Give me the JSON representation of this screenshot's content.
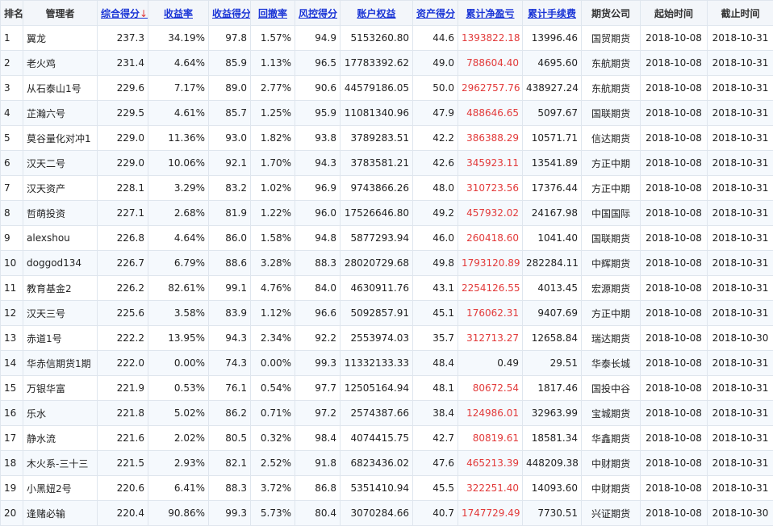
{
  "headers": {
    "rank": "排名",
    "manager": "管理者",
    "overall": "综合得分",
    "return_rate": "收益率",
    "return_score": "收益得分",
    "drawdown": "回撤率",
    "risk_score": "风控得分",
    "equity": "账户权益",
    "asset_score": "资产得分",
    "net_pnl": "累计净盈亏",
    "fees": "累计手续费",
    "broker": "期货公司",
    "start_time": "起始时间",
    "end_time": "截止时间",
    "sort_arrow": "↓"
  },
  "colors": {
    "link_header": "#1a35d6",
    "profit_red": "#e23a3a",
    "grid_line": "#dfe6ee",
    "header_bg": "#f3f6fa",
    "stripe_bg": "#f5f9fd"
  },
  "rows": [
    {
      "rank": "1",
      "manager": "翼龙",
      "overall": "237.3",
      "return_rate": "34.19%",
      "return_score": "97.8",
      "drawdown": "1.57%",
      "risk_score": "94.9",
      "equity": "5153260.80",
      "asset_score": "44.6",
      "net_pnl": "1393822.18",
      "fees": "13996.46",
      "broker": "国贸期货",
      "start_time": "2018-10-08",
      "end_time": "2018-10-31"
    },
    {
      "rank": "2",
      "manager": "老火鸡",
      "overall": "231.4",
      "return_rate": "4.64%",
      "return_score": "85.9",
      "drawdown": "1.13%",
      "risk_score": "96.5",
      "equity": "17783392.62",
      "asset_score": "49.0",
      "net_pnl": "788604.40",
      "fees": "4695.60",
      "broker": "东航期货",
      "start_time": "2018-10-08",
      "end_time": "2018-10-31"
    },
    {
      "rank": "3",
      "manager": "从石泰山1号",
      "overall": "229.6",
      "return_rate": "7.17%",
      "return_score": "89.0",
      "drawdown": "2.77%",
      "risk_score": "90.6",
      "equity": "44579186.05",
      "asset_score": "50.0",
      "net_pnl": "2962757.76",
      "fees": "438927.24",
      "broker": "东航期货",
      "start_time": "2018-10-08",
      "end_time": "2018-10-31"
    },
    {
      "rank": "4",
      "manager": "芷瀚六号",
      "overall": "229.5",
      "return_rate": "4.61%",
      "return_score": "85.7",
      "drawdown": "1.25%",
      "risk_score": "95.9",
      "equity": "11081340.96",
      "asset_score": "47.9",
      "net_pnl": "488646.65",
      "fees": "5097.67",
      "broker": "国联期货",
      "start_time": "2018-10-08",
      "end_time": "2018-10-31"
    },
    {
      "rank": "5",
      "manager": "莫谷量化对冲1",
      "overall": "229.0",
      "return_rate": "11.36%",
      "return_score": "93.0",
      "drawdown": "1.82%",
      "risk_score": "93.8",
      "equity": "3789283.51",
      "asset_score": "42.2",
      "net_pnl": "386388.29",
      "fees": "10571.71",
      "broker": "信达期货",
      "start_time": "2018-10-08",
      "end_time": "2018-10-31"
    },
    {
      "rank": "6",
      "manager": "汉天二号",
      "overall": "229.0",
      "return_rate": "10.06%",
      "return_score": "92.1",
      "drawdown": "1.70%",
      "risk_score": "94.3",
      "equity": "3783581.21",
      "asset_score": "42.6",
      "net_pnl": "345923.11",
      "fees": "13541.89",
      "broker": "方正中期",
      "start_time": "2018-10-08",
      "end_time": "2018-10-31"
    },
    {
      "rank": "7",
      "manager": "汉天资产",
      "overall": "228.1",
      "return_rate": "3.29%",
      "return_score": "83.2",
      "drawdown": "1.02%",
      "risk_score": "96.9",
      "equity": "9743866.26",
      "asset_score": "48.0",
      "net_pnl": "310723.56",
      "fees": "17376.44",
      "broker": "方正中期",
      "start_time": "2018-10-08",
      "end_time": "2018-10-31"
    },
    {
      "rank": "8",
      "manager": "哲萌投资",
      "overall": "227.1",
      "return_rate": "2.68%",
      "return_score": "81.9",
      "drawdown": "1.22%",
      "risk_score": "96.0",
      "equity": "17526646.80",
      "asset_score": "49.2",
      "net_pnl": "457932.02",
      "fees": "24167.98",
      "broker": "中国国际",
      "start_time": "2018-10-08",
      "end_time": "2018-10-31"
    },
    {
      "rank": "9",
      "manager": "alexshou",
      "overall": "226.8",
      "return_rate": "4.64%",
      "return_score": "86.0",
      "drawdown": "1.58%",
      "risk_score": "94.8",
      "equity": "5877293.94",
      "asset_score": "46.0",
      "net_pnl": "260418.60",
      "fees": "1041.40",
      "broker": "国联期货",
      "start_time": "2018-10-08",
      "end_time": "2018-10-31"
    },
    {
      "rank": "10",
      "manager": "doggod134",
      "overall": "226.7",
      "return_rate": "6.79%",
      "return_score": "88.6",
      "drawdown": "3.28%",
      "risk_score": "88.3",
      "equity": "28020729.68",
      "asset_score": "49.8",
      "net_pnl": "1793120.89",
      "fees": "282284.11",
      "broker": "中辉期货",
      "start_time": "2018-10-08",
      "end_time": "2018-10-31"
    },
    {
      "rank": "11",
      "manager": "教育基金2",
      "overall": "226.2",
      "return_rate": "82.61%",
      "return_score": "99.1",
      "drawdown": "4.76%",
      "risk_score": "84.0",
      "equity": "4630911.76",
      "asset_score": "43.1",
      "net_pnl": "2254126.55",
      "fees": "4013.45",
      "broker": "宏源期货",
      "start_time": "2018-10-08",
      "end_time": "2018-10-31"
    },
    {
      "rank": "12",
      "manager": "汉天三号",
      "overall": "225.6",
      "return_rate": "3.58%",
      "return_score": "83.9",
      "drawdown": "1.12%",
      "risk_score": "96.6",
      "equity": "5092857.91",
      "asset_score": "45.1",
      "net_pnl": "176062.31",
      "fees": "9407.69",
      "broker": "方正中期",
      "start_time": "2018-10-08",
      "end_time": "2018-10-31"
    },
    {
      "rank": "13",
      "manager": "赤道1号",
      "overall": "222.2",
      "return_rate": "13.95%",
      "return_score": "94.3",
      "drawdown": "2.34%",
      "risk_score": "92.2",
      "equity": "2553974.03",
      "asset_score": "35.7",
      "net_pnl": "312713.27",
      "fees": "12658.84",
      "broker": "瑞达期货",
      "start_time": "2018-10-08",
      "end_time": "2018-10-30"
    },
    {
      "rank": "14",
      "manager": "华赤信期货1期",
      "overall": "222.0",
      "return_rate": "0.00%",
      "return_score": "74.3",
      "drawdown": "0.00%",
      "risk_score": "99.3",
      "equity": "11332133.33",
      "asset_score": "48.4",
      "net_pnl": "0.49",
      "fees": "29.51",
      "broker": "华泰长城",
      "start_time": "2018-10-08",
      "end_time": "2018-10-31"
    },
    {
      "rank": "15",
      "manager": "万银华富",
      "overall": "221.9",
      "return_rate": "0.53%",
      "return_score": "76.1",
      "drawdown": "0.54%",
      "risk_score": "97.7",
      "equity": "12505164.94",
      "asset_score": "48.1",
      "net_pnl": "80672.54",
      "fees": "1817.46",
      "broker": "国投中谷",
      "start_time": "2018-10-08",
      "end_time": "2018-10-31"
    },
    {
      "rank": "16",
      "manager": "乐水",
      "overall": "221.8",
      "return_rate": "5.02%",
      "return_score": "86.2",
      "drawdown": "0.71%",
      "risk_score": "97.2",
      "equity": "2574387.66",
      "asset_score": "38.4",
      "net_pnl": "124986.01",
      "fees": "32963.99",
      "broker": "宝城期货",
      "start_time": "2018-10-08",
      "end_time": "2018-10-31"
    },
    {
      "rank": "17",
      "manager": "静水流",
      "overall": "221.6",
      "return_rate": "2.02%",
      "return_score": "80.5",
      "drawdown": "0.32%",
      "risk_score": "98.4",
      "equity": "4074415.75",
      "asset_score": "42.7",
      "net_pnl": "80819.61",
      "fees": "18581.34",
      "broker": "华鑫期货",
      "start_time": "2018-10-08",
      "end_time": "2018-10-31"
    },
    {
      "rank": "18",
      "manager": "木火系-三十三",
      "overall": "221.5",
      "return_rate": "2.93%",
      "return_score": "82.1",
      "drawdown": "2.52%",
      "risk_score": "91.8",
      "equity": "6823436.02",
      "asset_score": "47.6",
      "net_pnl": "465213.39",
      "fees": "448209.38",
      "broker": "中财期货",
      "start_time": "2018-10-08",
      "end_time": "2018-10-31"
    },
    {
      "rank": "19",
      "manager": "小黑妞2号",
      "overall": "220.6",
      "return_rate": "6.41%",
      "return_score": "88.3",
      "drawdown": "3.72%",
      "risk_score": "86.8",
      "equity": "5351410.94",
      "asset_score": "45.5",
      "net_pnl": "322251.40",
      "fees": "14093.60",
      "broker": "中财期货",
      "start_time": "2018-10-08",
      "end_time": "2018-10-31"
    },
    {
      "rank": "20",
      "manager": "逢赌必输",
      "overall": "220.4",
      "return_rate": "90.86%",
      "return_score": "99.3",
      "drawdown": "5.73%",
      "risk_score": "80.4",
      "equity": "3070284.66",
      "asset_score": "40.7",
      "net_pnl": "1747729.49",
      "fees": "7730.51",
      "broker": "兴证期货",
      "start_time": "2018-10-08",
      "end_time": "2018-10-30"
    }
  ]
}
